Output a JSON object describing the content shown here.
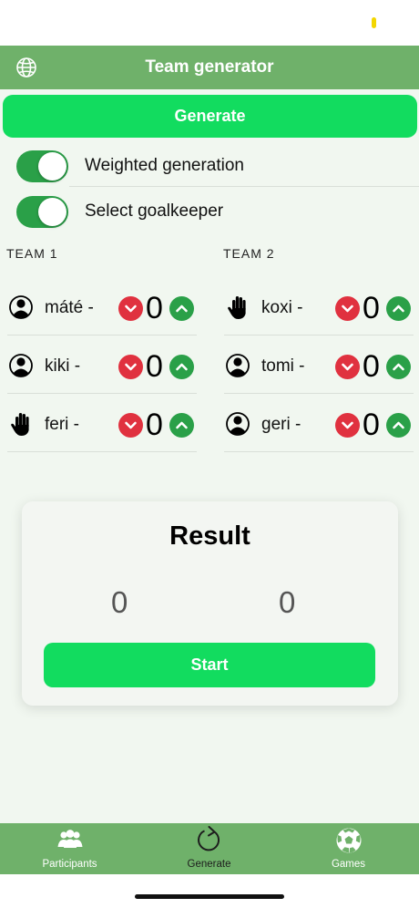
{
  "header": {
    "title": "Team generator",
    "globe_icon": "globe-icon"
  },
  "generate_button": "Generate",
  "toggles": [
    {
      "label": "Weighted generation",
      "on": true
    },
    {
      "label": "Select goalkeeper",
      "on": true
    }
  ],
  "teams": [
    {
      "title": "TEAM 1",
      "players": [
        {
          "name": "máté -",
          "role_icon": "person-icon",
          "score": "0"
        },
        {
          "name": "kiki -",
          "role_icon": "person-icon",
          "score": "0"
        },
        {
          "name": "feri -",
          "role_icon": "hand-icon",
          "score": "0"
        }
      ]
    },
    {
      "title": "TEAM 2",
      "players": [
        {
          "name": "koxi -",
          "role_icon": "hand-icon",
          "score": "0"
        },
        {
          "name": "tomi -",
          "role_icon": "person-icon",
          "score": "0"
        },
        {
          "name": "geri -",
          "role_icon": "person-icon",
          "score": "0"
        }
      ]
    }
  ],
  "result": {
    "title": "Result",
    "team1_score": "0",
    "team2_score": "0",
    "start_label": "Start"
  },
  "tabs": [
    {
      "label": "Participants",
      "icon": "participants-icon"
    },
    {
      "label": "Generate",
      "icon": "refresh-icon",
      "active": true
    },
    {
      "label": "Games",
      "icon": "soccer-ball-icon"
    }
  ],
  "colors": {
    "nav_green": "#6fb16a",
    "button_green": "#12dc5f",
    "toggle_green": "#2aa048",
    "decrement_red": "#e0313f",
    "background": "#f1f7f0"
  }
}
